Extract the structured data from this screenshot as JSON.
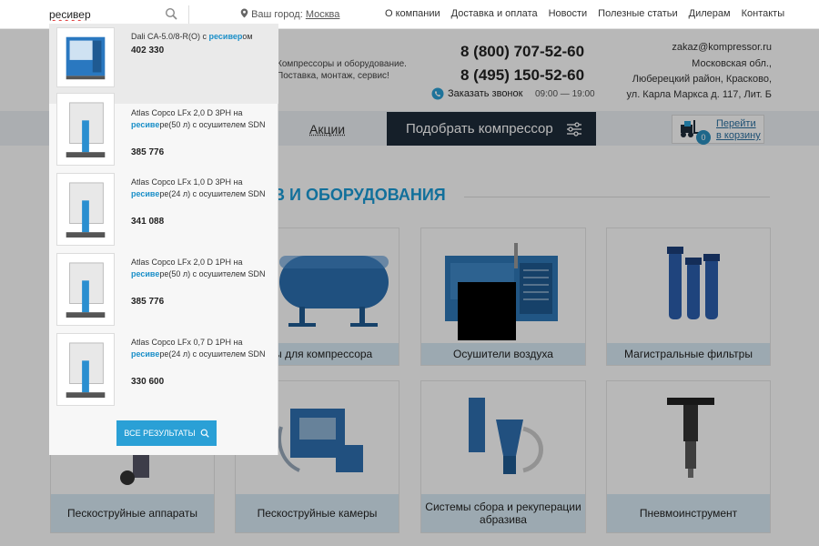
{
  "search": {
    "value": "ресивер"
  },
  "city": {
    "label": "Ваш город:",
    "value": "Москва"
  },
  "nav": [
    {
      "label": "О компании"
    },
    {
      "label": "Доставка и оплата"
    },
    {
      "label": "Новости"
    },
    {
      "label": "Полезные статьи"
    },
    {
      "label": "Дилерам"
    },
    {
      "label": "Контакты"
    }
  ],
  "header": {
    "tagline": "Компрессоры и оборудование. Поставка, монтаж, сервис!",
    "phone1": "8 (800) 707-52-60",
    "phone2": "8 (495) 150-52-60",
    "callback": "Заказать звонок",
    "hours": "09:00 — 19:00",
    "email": "zakaz@kompressor.ru",
    "address": [
      "Московская обл.,",
      "Люберецкий район, Красково,",
      "ул. Карла Маркса д. 117, Лит. Б"
    ]
  },
  "menu": {
    "promo": "Акции",
    "select_compressor": "Подобрать компрессор",
    "cart_count": "0",
    "cart_label": [
      "Перейти",
      "в корзину"
    ]
  },
  "section": {
    "title": "В И ОБОРУДОВАНИЯ"
  },
  "cards": [
    {
      "label": "еры для компрессора"
    },
    {
      "label": "Осушители воздуха"
    },
    {
      "label": "Магистральные фильтры"
    },
    {
      "label": "Пескоструйные аппараты"
    },
    {
      "label": "Пескоструйные камеры"
    },
    {
      "label": "Системы сбора и рекуперации абразива"
    },
    {
      "label": "Пневмоинструмент"
    }
  ],
  "dropdown": {
    "items": [
      {
        "pre": "Dali CA-5.0/8-R(O) с ",
        "hl": "ресивер",
        "post": "ом",
        "price": "402 330"
      },
      {
        "pre": "Atlas Copco LFx 2,0 D 3PH на ",
        "hl": "ресиве",
        "post": "ре(50 л) с осушителем SDN",
        "price": "385 776"
      },
      {
        "pre": "Atlas Copco LFx 1,0 D 3PH на ",
        "hl": "ресиве",
        "post": "ре(24 л) с осушителем SDN",
        "price": "341 088"
      },
      {
        "pre": "Atlas Copco LFx 2,0 D 1PH на ",
        "hl": "ресиве",
        "post": "ре(50 л) с осушителем SDN",
        "price": "385 776"
      },
      {
        "pre": "Atlas Copco LFx 0,7 D 1PH на ",
        "hl": "ресиве",
        "post": "ре(24 л) с осушителем SDN",
        "price": "330 600"
      }
    ],
    "all_results": "ВСЕ РЕЗУЛЬТАТЫ"
  },
  "colors": {
    "accent": "#1a9bd7",
    "dark_button": "#1e2b3a",
    "caption_bg": "#d9ebf5",
    "highlight": "#1a8fc8"
  }
}
